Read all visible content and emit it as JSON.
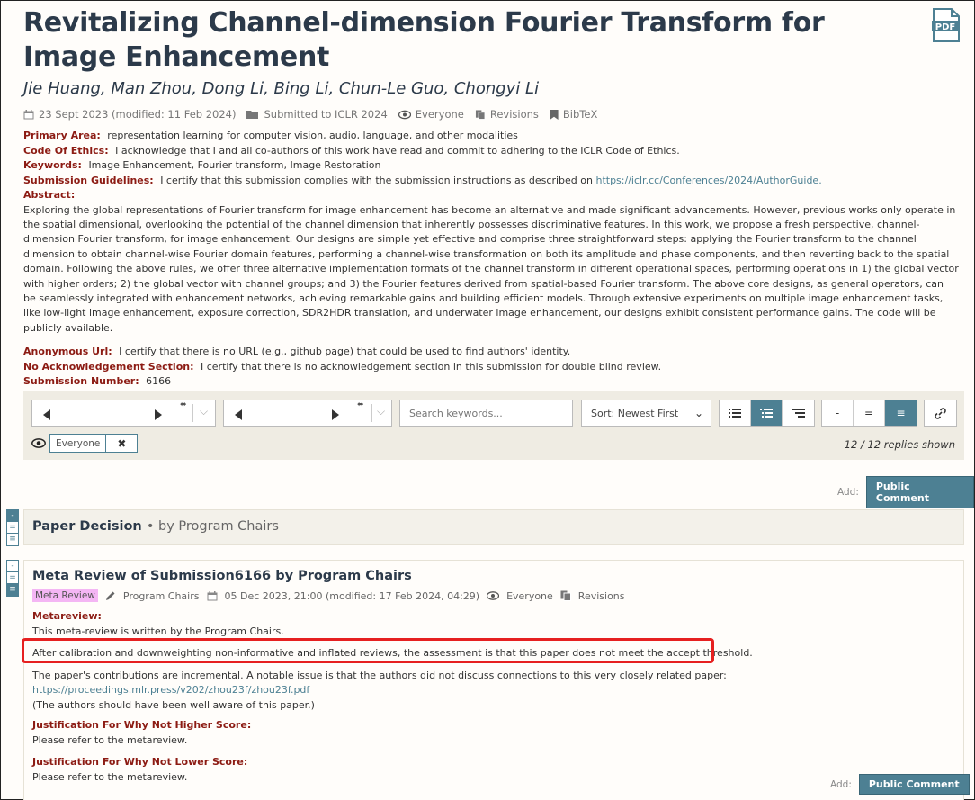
{
  "paper": {
    "title": "Revitalizing Channel-dimension Fourier Transform for Image Enhancement",
    "authors": "Jie Huang, Man Zhou, Dong Li, Bing Li, Chun-Le Guo, Chongyi Li",
    "date": "23 Sept 2023 (modified: 11 Feb 2024)",
    "venue": "Submitted to ICLR 2024",
    "readers": "Everyone",
    "revisions": "Revisions",
    "bibtex": "BibTeX",
    "pdf_label": "PDF"
  },
  "fields": {
    "primary_area_label": "Primary Area:",
    "primary_area": "representation learning for computer vision, audio, language, and other modalities",
    "ethics_label": "Code Of Ethics:",
    "ethics": "I acknowledge that I and all co-authors of this work have read and commit to adhering to the ICLR Code of Ethics.",
    "keywords_label": "Keywords:",
    "keywords": "Image Enhancement, Fourier transform, Image Restoration",
    "guidelines_label": "Submission Guidelines:",
    "guidelines": "I certify that this submission complies with the submission instructions as described on",
    "guidelines_link": "https://iclr.cc/Conferences/2024/AuthorGuide.",
    "abstract_label": "Abstract:",
    "abstract": "Exploring the global representations of Fourier transform for image enhancement has become an alternative and made significant advancements. However, previous works only operate in the spatial dimensional, overlooking the potential of the channel dimension that inherently possesses discriminative features. In this work, we propose a fresh perspective, channel-dimension Fourier transform, for image enhancement. Our designs are simple yet effective and comprise three straightforward steps: applying the Fourier transform to the channel dimension to obtain channel-wise Fourier domain features, performing a channel-wise transformation on both its amplitude and phase components, and then reverting back to the spatial domain. Following the above rules, we offer three alternative implementation formats of the channel transform in different operational spaces, performing operations in 1) the global vector with higher orders; 2) the global vector with channel groups; and 3) the Fourier features derived from spatial-based Fourier transform. The above core designs, as general operators, can be seamlessly integrated with enhancement networks, achieving remarkable gains and building efficient models. Through extensive experiments on multiple image enhancement tasks, like low-light image enhancement, exposure correction, SDR2HDR translation, and underwater image enhancement, our designs exhibit consistent performance gains. The code will be publicly available.",
    "anon_url_label": "Anonymous Url:",
    "anon_url": "I certify that there is no URL (e.g., github page) that could be used to find authors' identity.",
    "no_ack_label": "No Acknowledgement Section:",
    "no_ack": "I certify that there is no acknowledgement section in this submission for double blind review.",
    "subnum_label": "Submission Number:",
    "subnum": "6166"
  },
  "filters": {
    "search_placeholder": "Search keywords...",
    "sort": "Sort: Newest First",
    "readers_chip": "Everyone",
    "replies": "12 / 12 replies shown",
    "expand_buttons": [
      "-",
      "=",
      "≡"
    ],
    "link_icon": "link-icon",
    "view_icons": [
      "list-icon",
      "threaded-icon",
      "nested-icon"
    ]
  },
  "add": {
    "label": "Add:",
    "button": "Public Comment"
  },
  "decision": {
    "title": "Paper Decision",
    "by": "by Program Chairs"
  },
  "meta_review": {
    "title": "Meta Review of Submission6166 by Program Chairs",
    "badge": "Meta Review",
    "signature": "Program Chairs",
    "date": "05 Dec 2023, 21:00 (modified: 17 Feb 2024, 04:29)",
    "readers": "Everyone",
    "revisions": "Revisions",
    "metareview_label": "Metareview:",
    "p1": "This meta-review is written by the Program Chairs.",
    "p2": "After calibration and downweighting non-informative and inflated reviews, the assessment is that this paper does not meet the accept threshold.",
    "p3": "The paper's contributions are incremental. A notable issue is that the authors did not discuss connections to this very closely related paper:",
    "p3_link": "https://proceedings.mlr.press/v202/zhou23f/zhou23f.pdf",
    "p4": "(The authors should have been well aware of this paper.)",
    "higher_label": "Justification For Why Not Higher Score:",
    "higher": "Please refer to the metareview.",
    "lower_label": "Justification For Why Not Lower Score:",
    "lower": "Please refer to the metareview."
  },
  "colors": {
    "accent": "#4d8093",
    "label": "#8c1b13",
    "highlight": "#e62020",
    "badge": "#f4b6f4"
  }
}
